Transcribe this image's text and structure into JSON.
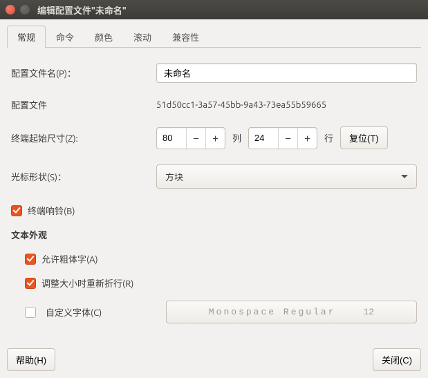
{
  "window": {
    "title": "编辑配置文件\"未命名\""
  },
  "tabs": {
    "general": "常规",
    "command": "命令",
    "colors": "颜色",
    "scrolling": "滚动",
    "compat": "兼容性"
  },
  "fields": {
    "profile_name_label": "配置文件名(P)：",
    "profile_name_value": "未命名",
    "profile_id_label": "配置文件",
    "profile_id_value": "51d50cc1-3a57-45bb-9a43-73ea55b59665",
    "initial_size_label": "终端起始尺寸(Z):",
    "cols_value": "80",
    "cols_label": "列",
    "rows_value": "24",
    "rows_label": "行",
    "reset_label": "复位(T)",
    "cursor_shape_label": "光标形状(S)：",
    "cursor_shape_value": "方块",
    "terminal_bell_label": "终端响铃(B)",
    "text_appearance_title": "文本外观",
    "allow_bold_label": "允许粗体字(A)",
    "rewrap_label": "调整大小时重新折行(R)",
    "custom_font_label": "自定义字体(C)",
    "font_name": "Monospace Regular",
    "font_size": "12"
  },
  "footer": {
    "help": "帮助(H)",
    "close": "关闭(C)"
  }
}
